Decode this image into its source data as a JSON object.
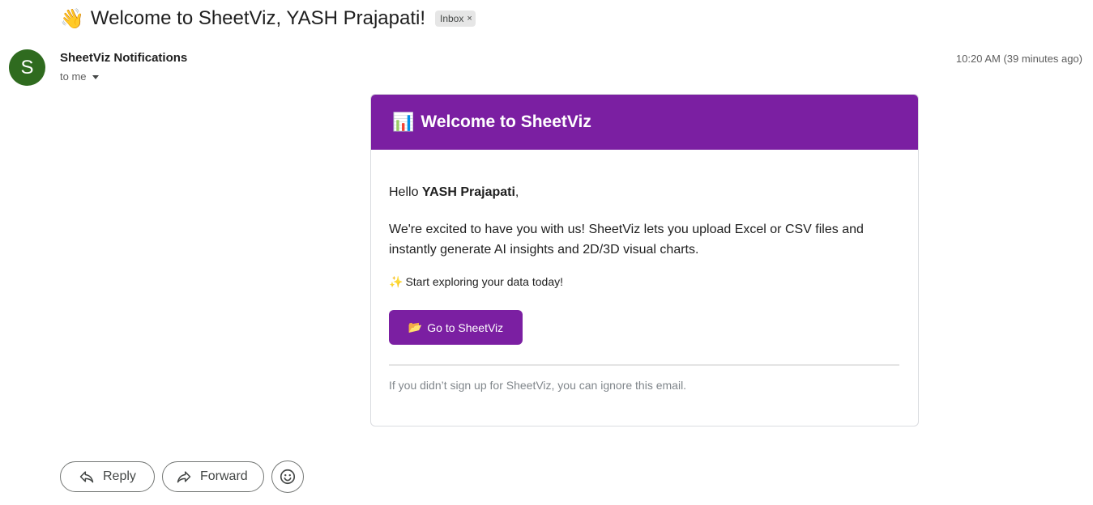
{
  "subject": {
    "emoji": "👋",
    "text": "Welcome to SheetViz, YASH Prajapati!",
    "label": "Inbox",
    "label_remove": "×"
  },
  "sender": {
    "avatar_letter": "S",
    "avatar_color": "#2f6b1f",
    "name": "SheetViz Notifications",
    "recipient": "to me",
    "timestamp": "10:20 AM (39 minutes ago)"
  },
  "email": {
    "header_icon": "📊",
    "header_title": "Welcome to SheetViz",
    "brand_color": "#7b1fa2",
    "greeting_prefix": "Hello ",
    "greeting_name": "YASH Prajapati",
    "greeting_suffix": ",",
    "intro": "We're excited to have you with us! SheetViz lets you upload Excel or CSV files and instantly generate AI insights and 2D/3D visual charts.",
    "explore_icon": "✨",
    "explore_text": "Start exploring your data today!",
    "cta_icon": "📂",
    "cta_label": "Go to SheetViz",
    "footer_note": "If you didn’t sign up for SheetViz, you can ignore this email."
  },
  "actions": {
    "reply_label": "Reply",
    "forward_label": "Forward",
    "reply_icon": "reply-icon",
    "forward_icon": "forward-icon",
    "emoji_icon": "smiley-icon"
  }
}
